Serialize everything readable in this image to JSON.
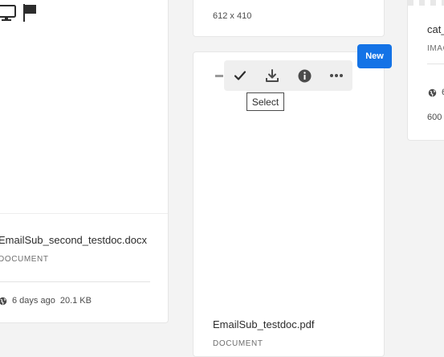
{
  "cards": {
    "left": {
      "title": "EmailSub_second_testdoc.docx",
      "type": "DOCUMENT",
      "modified": "6 days ago",
      "size": "20.1 KB"
    },
    "mid_top": {
      "dimensions": "612 x 410"
    },
    "mid": {
      "title": "EmailSub_testdoc.pdf",
      "type": "DOCUMENT",
      "badge": "New"
    },
    "right": {
      "title": "cat_",
      "type": "IMAG",
      "modified": "6",
      "dimensions": "600"
    }
  },
  "quick_actions": {
    "tooltip": "Select",
    "icons": [
      "check-icon",
      "download-icon",
      "info-icon",
      "more-icon"
    ]
  },
  "left_icons": [
    "desktop-icon",
    "flag-icon"
  ],
  "colors": {
    "accent": "#1473e6",
    "background": "#f3f3f3",
    "card": "#ffffff",
    "text": "#2c2c2c",
    "muted": "#6e6e6e"
  }
}
